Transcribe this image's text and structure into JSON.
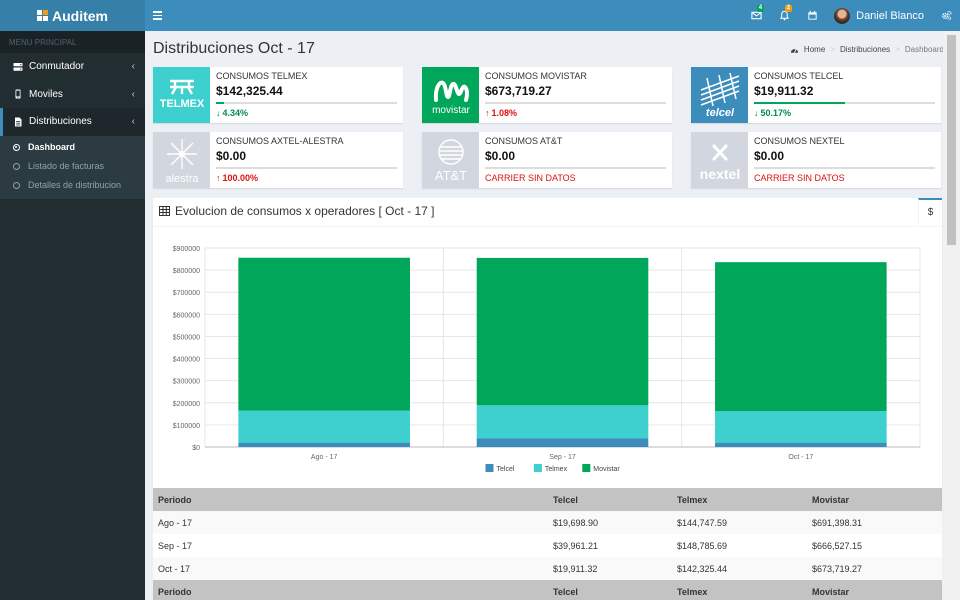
{
  "app": {
    "name": "Auditem"
  },
  "header": {
    "mail_badge": "4",
    "bell_badge": "2",
    "user_name": "Daniel Blanco"
  },
  "sidebar": {
    "section_label": "MENU PRINCIPAL",
    "items": [
      {
        "label": "Conmutador",
        "icon": "server-icon"
      },
      {
        "label": "Moviles",
        "icon": "mobile-icon"
      },
      {
        "label": "Distribuciones",
        "icon": "file-icon"
      }
    ],
    "submenu": [
      {
        "label": "Dashboard"
      },
      {
        "label": "Listado de facturas"
      },
      {
        "label": "Detalles de distribucion"
      }
    ]
  },
  "page": {
    "title": "Distribuciones Oct - 17",
    "breadcrumb": [
      "Home",
      "Distribuciones",
      "Dashboard"
    ]
  },
  "cards": [
    {
      "label": "CONSUMOS TELMEX",
      "value": "$142,325.44",
      "desc": "4.34%",
      "trend": "down",
      "logo": "TELMEX",
      "color": "#3ecfcf",
      "progress": 0.0434
    },
    {
      "label": "CONSUMOS MOVISTAR",
      "value": "$673,719.27",
      "desc": "1.08%",
      "trend": "up",
      "logo": "movistar",
      "color": "#00a65a",
      "progress": 0
    },
    {
      "label": "CONSUMOS TELCEL",
      "value": "$19,911.32",
      "desc": "50.17%",
      "trend": "down",
      "logo": "telcel",
      "color": "#3c8dbc",
      "progress": 0.5017
    },
    {
      "label": "CONSUMOS AXTEL-ALESTRA",
      "value": "$0.00",
      "desc": "100.00%",
      "trend": "up",
      "logo": "alestra",
      "color": "#d2d6de",
      "progress": 0
    },
    {
      "label": "CONSUMOS AT&T",
      "value": "$0.00",
      "desc": "CARRIER SIN DATOS",
      "trend": "none",
      "logo": "AT&T",
      "color": "#d2d6de",
      "progress": 0
    },
    {
      "label": "CONSUMOS NEXTEL",
      "value": "$0.00",
      "desc": "CARRIER SIN DATOS",
      "trend": "none",
      "logo": "nextel",
      "color": "#d2d6de",
      "progress": 0
    }
  ],
  "chart": {
    "title": "Evolucion de consumos x operadores [ Oct - 17 ]",
    "tab_label": "$"
  },
  "chart_data": {
    "type": "bar",
    "stacked": true,
    "categories": [
      "Ago - 17",
      "Sep - 17",
      "Oct - 17"
    ],
    "series": [
      {
        "name": "Telcel",
        "color": "#3c8dbc",
        "values": [
          19698.9,
          39961.21,
          19911.32
        ]
      },
      {
        "name": "Telmex",
        "color": "#3ecfcf",
        "values": [
          144747.59,
          148785.69,
          142325.44
        ]
      },
      {
        "name": "Movistar",
        "color": "#00a65a",
        "values": [
          691398.31,
          666527.15,
          673719.27
        ]
      }
    ],
    "ylim": [
      0,
      900000
    ],
    "yticks": [
      "$0",
      "$100000",
      "$200000",
      "$300000",
      "$400000",
      "$500000",
      "$600000",
      "$700000",
      "$800000",
      "$900000"
    ],
    "grid": true,
    "legend": "bottom"
  },
  "table": {
    "headers": [
      "Periodo",
      "Telcel",
      "Telmex",
      "Movistar"
    ],
    "rows": [
      [
        "Ago - 17",
        "$19,698.90",
        "$144,747.59",
        "$691,398.31"
      ],
      [
        "Sep - 17",
        "$39,961.21",
        "$148,785.69",
        "$666,527.15"
      ],
      [
        "Oct - 17",
        "$19,911.32",
        "$142,325.44",
        "$673,719.27"
      ]
    ],
    "footer": [
      "Periodo",
      "Telcel",
      "Telmex",
      "Movistar"
    ]
  }
}
